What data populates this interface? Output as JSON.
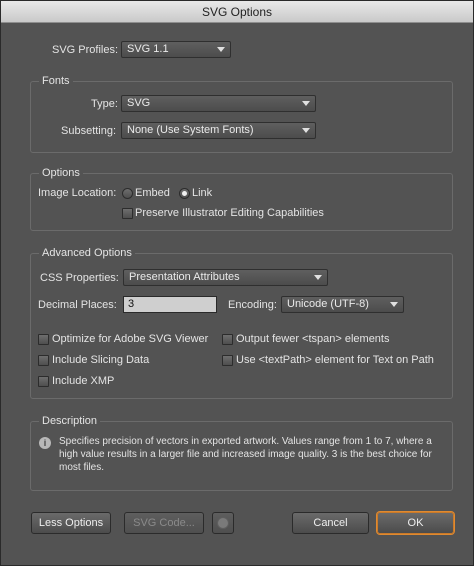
{
  "window": {
    "title": "SVG Options"
  },
  "profiles": {
    "label": "SVG Profiles:",
    "value": "SVG 1.1"
  },
  "fonts": {
    "group_title": "Fonts",
    "type_label": "Type:",
    "type_value": "SVG",
    "subsetting_label": "Subsetting:",
    "subsetting_value": "None (Use System Fonts)"
  },
  "options": {
    "group_title": "Options",
    "image_location_label": "Image Location:",
    "embed_label": "Embed",
    "link_label": "Link",
    "selected": "Link",
    "preserve_label": "Preserve Illustrator Editing Capabilities"
  },
  "advanced": {
    "group_title": "Advanced Options",
    "css_label": "CSS Properties:",
    "css_value": "Presentation Attributes",
    "decimal_label": "Decimal Places:",
    "decimal_value": "3",
    "encoding_label": "Encoding:",
    "encoding_value": "Unicode (UTF-8)",
    "checks": {
      "optimize": "Optimize for Adobe SVG Viewer",
      "slicing": "Include Slicing Data",
      "xmp": "Include XMP",
      "tspan": "Output fewer <tspan> elements",
      "textpath": "Use <textPath> element for Text on Path"
    }
  },
  "description": {
    "group_title": "Description",
    "text": "Specifies precision of vectors in exported artwork. Values range from 1 to 7, where a high value results in a larger file and increased image quality. 3 is the best choice for most files."
  },
  "buttons": {
    "less_options": "Less Options",
    "svg_code": "SVG Code...",
    "cancel": "Cancel",
    "ok": "OK"
  },
  "icons": {
    "info": "info-icon",
    "globe": "globe-icon",
    "dropdown": "chevron-down-icon"
  }
}
